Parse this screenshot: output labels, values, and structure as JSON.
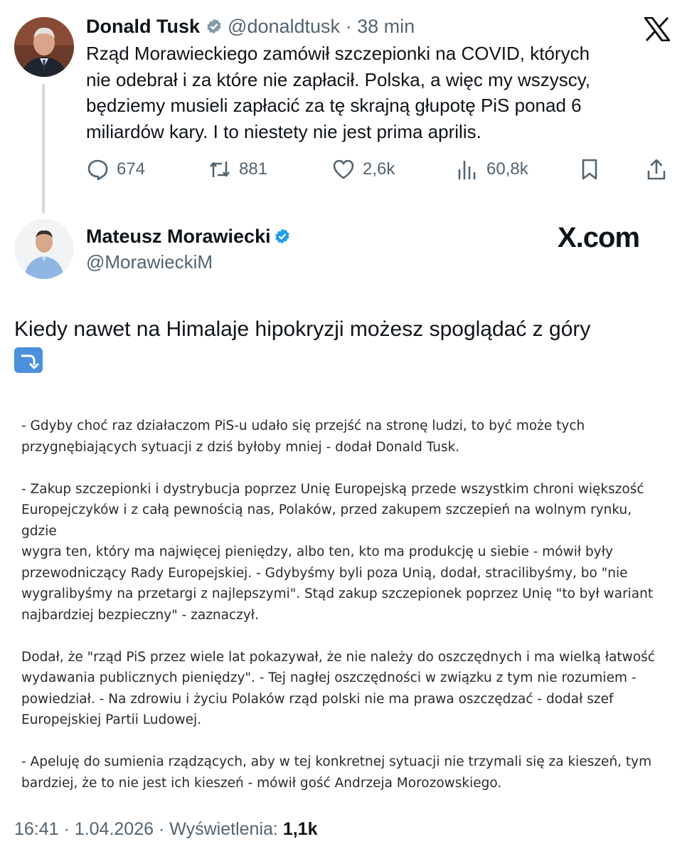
{
  "tweet1": {
    "author_name": "Donald Tusk",
    "handle": "@donaldtusk",
    "separator": "·",
    "time": "38 min",
    "text": "Rząd Morawieckiego zamówił szczepionki na COVID, których\nnie odebrał i za które nie zapłacił. Polska, a więc my wszyscy,\nbędziemy musieli zapłacić za tę skrajną głupotę PiS ponad 6\nmiliardów kary. I to niestety nie jest prima aprilis.",
    "stats": {
      "replies": "674",
      "reposts": "881",
      "likes": "2,6k",
      "views": "60,8k"
    }
  },
  "tweet2": {
    "author_name": "Mateusz Morawiecki",
    "handle": "@MorawieckiM",
    "watermark": "X.com",
    "text": "Kiedy nawet na Himalaje hipokryzji możesz spoglądać z góry",
    "emoji": "arrow-right-hook-down",
    "article_paragraphs": [
      "- Gdyby choć raz działaczom PiS-u udało się przejść na stronę ludzi, to być może tych\nprzygnębiających sytuacji z dziś byłoby mniej - dodał Donald Tusk.",
      "- Zakup szczepionki i dystrybucja poprzez Unię Europejską przede wszystkim chroni większość\nEuropejczyków i z całą pewnością nas, Polaków, przed zakupem szczepień na wolnym rynku, gdzie\nwygra ten, który ma najwięcej pieniędzy, albo ten, kto ma produkcję u siebie - mówił były\nprzewodniczący Rady Europejskiej. - Gdybyśmy byli poza Unią, dodał, stracilibyśmy, bo \"nie\nwygralibyśmy na przetargi z najlepszymi\". Stąd zakup szczepionek poprzez Unię \"to był wariant\nnajbardziej bezpieczny\" - zaznaczył.",
      "Dodał, że \"rząd PiS przez wiele lat pokazywał, że nie należy do oszczędnych i ma wielką łatwość\nwydawania publicznych pieniędzy\". - Tej nagłej oszczędności w związku z tym nie rozumiem -\npowiedział. - Na zdrowiu i życiu Polaków rząd polski nie ma prawa oszczędzać - dodał szef\nEuropejskiej Partii Ludowej.",
      "- Apeluję do sumienia rządzących, aby w tej konkretnej sytuacji nie trzymali się za kieszeń, tym\nbardziej, że to nie jest ich kieszeń - mówił gość Andrzeja Morozowskiego."
    ],
    "footer": {
      "time": "16:41",
      "date": "1.04.2026",
      "views_label": "Wyświetlenia:",
      "views": "1,1k"
    }
  },
  "colors": {
    "verified": "#1d9bf0",
    "muted": "#536471",
    "thread_line": "#cfd9de",
    "emoji_bg": "#4c8fdc"
  }
}
